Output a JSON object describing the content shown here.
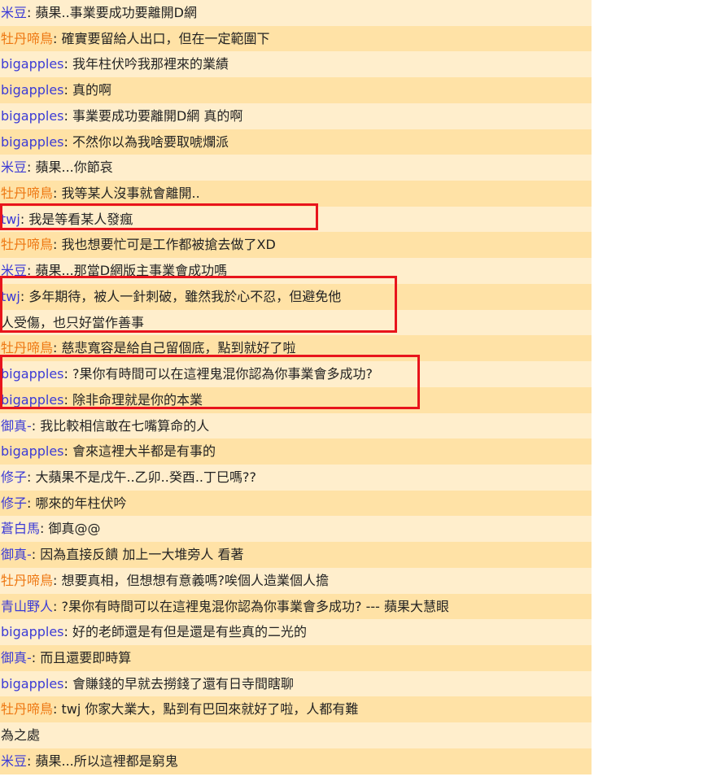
{
  "colors": {
    "row_light": "#ffeecc",
    "row_dark": "#ffe2a6",
    "user_blue": "#3b3bd6",
    "user_orange": "#ee7711",
    "highlight": "#e8141c"
  },
  "messages": [
    {
      "user": "米豆",
      "color": "blue",
      "text": "蘋果..事業要成功要離開D網"
    },
    {
      "user": "牡丹啼鳥",
      "color": "orange",
      "text": "確實要留給人出口，但在一定範圍下"
    },
    {
      "user": "bigapples",
      "color": "blue",
      "text": "我年柱伏吟我那裡來的業績"
    },
    {
      "user": "bigapples",
      "color": "blue",
      "text": "真的啊"
    },
    {
      "user": "bigapples",
      "color": "blue",
      "text": "事業要成功要離開D網 真的啊"
    },
    {
      "user": "bigapples",
      "color": "blue",
      "text": "不然你以為我啥要取唬爛派"
    },
    {
      "user": "米豆",
      "color": "blue",
      "text": "蘋果...你節哀"
    },
    {
      "user": "牡丹啼鳥",
      "color": "orange",
      "text": "我等某人沒事就會離開.."
    },
    {
      "user": "twj",
      "color": "blue",
      "text": "我是等看某人發瘋"
    },
    {
      "user": "牡丹啼鳥",
      "color": "orange",
      "text": "我也想要忙可是工作都被搶去做了XD"
    },
    {
      "user": "米豆",
      "color": "blue",
      "text": "蘋果...那當D網版主事業會成功嗎"
    },
    {
      "user": "twj",
      "color": "blue",
      "text": "多年期待，被人一針刺破，雖然我於心不忍，但避免他"
    },
    {
      "user": "",
      "color": "blue",
      "text": "人受傷，也只好當作善事"
    },
    {
      "user": "牡丹啼鳥",
      "color": "orange",
      "text": "慈悲寬容是給自己留個底，點到就好了啦"
    },
    {
      "user": "bigapples",
      "color": "blue",
      "text": "?果你有時間可以在這裡鬼混你認為你事業會多成功?"
    },
    {
      "user": "bigapples",
      "color": "blue",
      "text": "除非命理就是你的本業"
    },
    {
      "user": "御真-",
      "color": "blue",
      "text": "我比較相信敢在七嘴算命的人"
    },
    {
      "user": "bigapples",
      "color": "blue",
      "text": "會來這裡大半都是有事的"
    },
    {
      "user": "修子",
      "color": "blue",
      "text": "大蘋果不是戊午..乙卯..癸酉..丁巳嗎??"
    },
    {
      "user": "修子",
      "color": "blue",
      "text": "哪來的年柱伏吟"
    },
    {
      "user": "蒼白馬",
      "color": "blue",
      "text": "御真@@"
    },
    {
      "user": "御真-",
      "color": "blue",
      "text": "因為直接反饋 加上一大堆旁人 看著"
    },
    {
      "user": "牡丹啼鳥",
      "color": "orange",
      "text": "想要真相，但想想有意義嗎?唉個人造業個人擔"
    },
    {
      "user": "青山野人",
      "color": "blue",
      "text": "?果你有時間可以在這裡鬼混你認為你事業會多成功? --- 蘋果大慧眼"
    },
    {
      "user": "bigapples",
      "color": "blue",
      "text": "好的老師還是有但是還是有些真的二光的"
    },
    {
      "user": "御真-",
      "color": "blue",
      "text": "而且還要即時算"
    },
    {
      "user": "bigapples",
      "color": "blue",
      "text": "會賺錢的早就去撈錢了還有日寺間瞎聊"
    },
    {
      "user": "牡丹啼鳥",
      "color": "orange",
      "text": "twj 你家大業大，點到有巴回來就好了啦，人都有難"
    },
    {
      "user": "",
      "color": "blue",
      "text": "為之處"
    },
    {
      "user": "米豆",
      "color": "blue",
      "text": "蘋果...所以這裡都是窮鬼"
    }
  ]
}
